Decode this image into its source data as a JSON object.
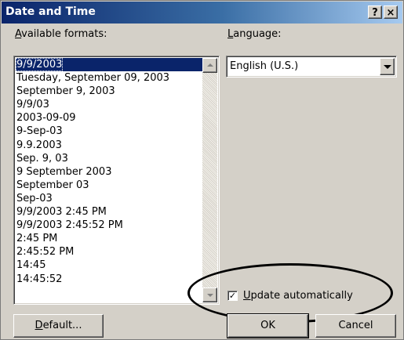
{
  "window": {
    "title": "Date and Time",
    "help_glyph": "?",
    "close_glyph": "×"
  },
  "formats": {
    "label_access_key": "A",
    "label_rest": "vailable formats:",
    "selected_index": 0,
    "items": [
      "9/9/2003",
      "Tuesday, September 09, 2003",
      "September 9, 2003",
      "9/9/03",
      "2003-09-09",
      "9-Sep-03",
      "9.9.2003",
      "Sep. 9, 03",
      "9 September 2003",
      "September 03",
      "Sep-03",
      "9/9/2003 2:45 PM",
      "9/9/2003 2:45:52 PM",
      "2:45 PM",
      "2:45:52 PM",
      "14:45",
      "14:45:52"
    ]
  },
  "language": {
    "label_access_key": "L",
    "label_rest": "anguage:",
    "value": "English (U.S.)"
  },
  "update": {
    "checked": true,
    "check_glyph": "✓",
    "label_access_key": "U",
    "label_rest": "pdate automatically"
  },
  "buttons": {
    "default_access_key": "D",
    "default_rest": "efault...",
    "ok": "OK",
    "cancel": "Cancel"
  },
  "annotation": {
    "shape": "oval",
    "color": "#000000",
    "target": "update-automatically-checkbox"
  },
  "colors": {
    "titlebar": "#0a246a",
    "dialog_face": "#d4d0c8",
    "selection": "#0a246a"
  }
}
